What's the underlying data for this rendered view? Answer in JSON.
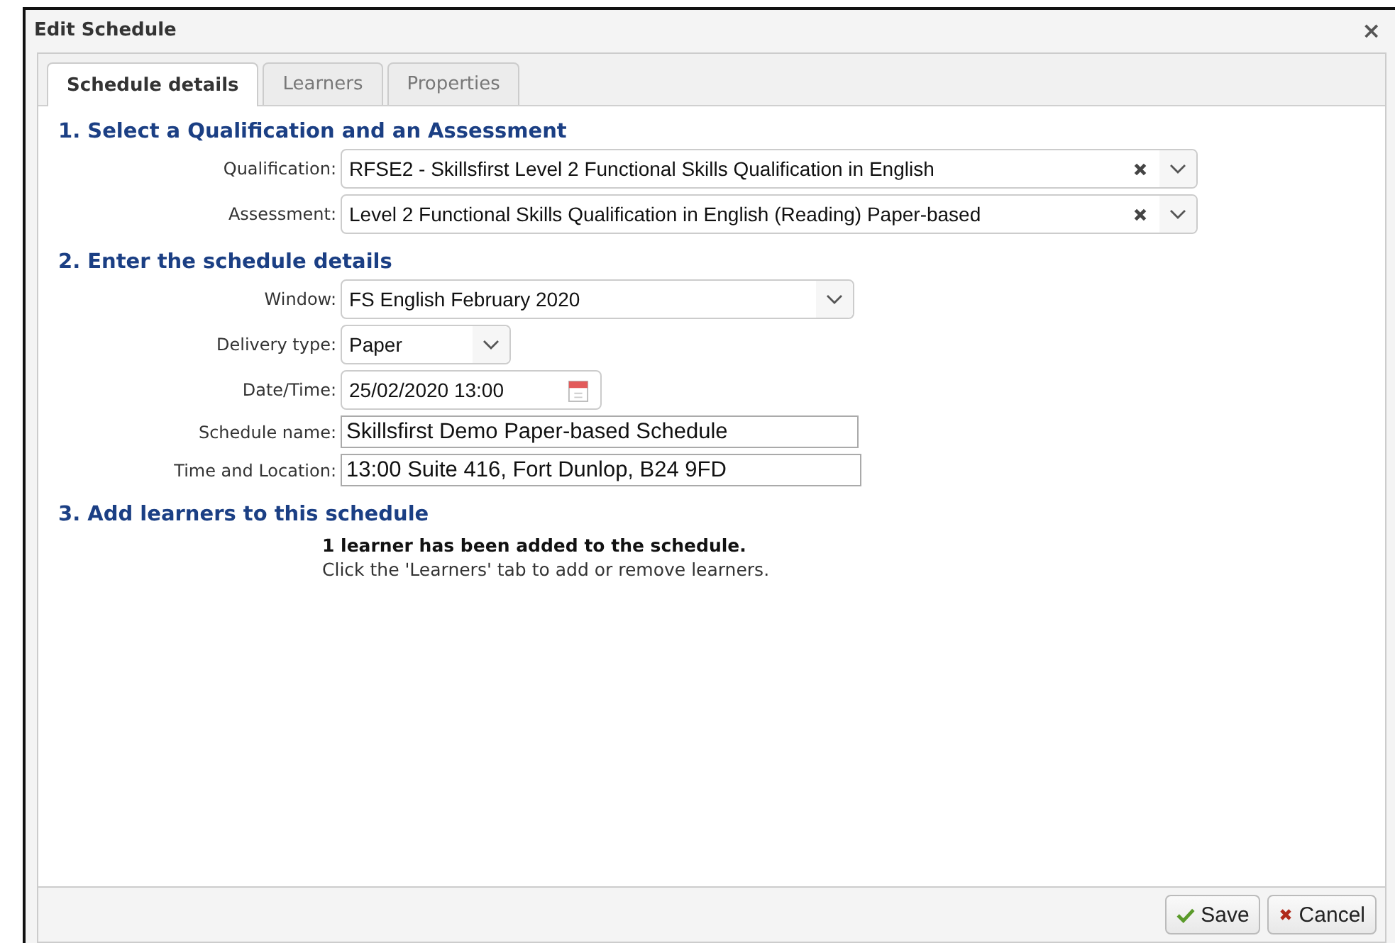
{
  "window": {
    "title": "Edit Schedule",
    "close": "×"
  },
  "tabs": [
    {
      "label": "Schedule details",
      "selected": true
    },
    {
      "label": "Learners",
      "selected": false
    },
    {
      "label": "Properties",
      "selected": false
    }
  ],
  "sections": [
    {
      "heading": "1. Select a Qualification and an Assessment",
      "fields": [
        {
          "label": "Qualification:",
          "kind": "combo",
          "value": "RFSE2 - Skillsfirst Level 2 Functional Skills Qualification in English"
        },
        {
          "label": "Assessment:",
          "kind": "combo",
          "value": "Level 2 Functional Skills Qualification in English (Reading) Paper-based"
        }
      ]
    },
    {
      "heading": "2. Enter the schedule details",
      "fields": [
        {
          "label": "Window:",
          "kind": "select",
          "value": "FS English February 2020"
        },
        {
          "label": "Delivery type:",
          "kind": "select",
          "value": "Paper"
        },
        {
          "label": "Date/Time:",
          "kind": "date",
          "value": "25/02/2020 13:00"
        },
        {
          "label": "Schedule name:",
          "kind": "text",
          "value": "Skillsfirst Demo Paper-based Schedule"
        },
        {
          "label": "Time and Location:",
          "kind": "text",
          "value": "13:00 Suite 416, Fort Dunlop, B24 9FD"
        }
      ]
    },
    {
      "heading": "3. Add learners to this schedule",
      "notice": "1 learner has been added to the schedule.",
      "hint": "Click the 'Learners' tab to add or remove learners."
    }
  ],
  "buttons": [
    {
      "label": "Save",
      "kind": "save"
    },
    {
      "label": "Cancel",
      "kind": "cancel"
    }
  ]
}
